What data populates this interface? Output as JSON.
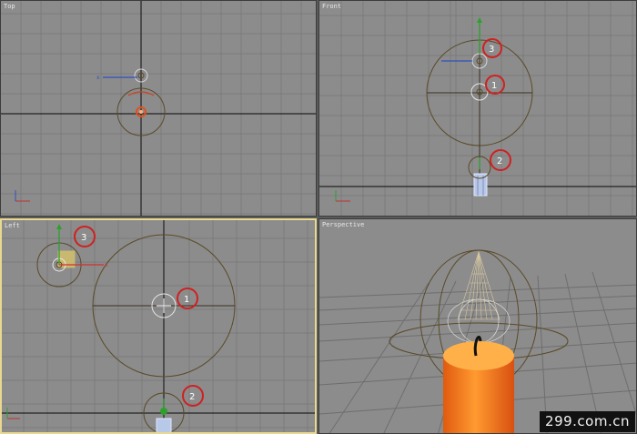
{
  "viewports": {
    "top": {
      "label": "Top"
    },
    "front": {
      "label": "Front"
    },
    "left": {
      "label": "Left"
    },
    "perspective": {
      "label": "Perspective"
    }
  },
  "markers": {
    "front": [
      "3",
      "1",
      "2"
    ],
    "left": [
      "3",
      "1",
      "2"
    ]
  },
  "axis_labels": {
    "x": "x",
    "y": "y",
    "z": "z"
  },
  "watermark": "299.com.cn",
  "colors": {
    "viewport_bg": "#8c8c8c",
    "grid": "#7d7d7d",
    "major_axis": "#1e1e1e",
    "helper": "#5a4a28",
    "marker_ring": "#d02020",
    "active_border": "#e8d890",
    "candle": "#f07818",
    "flame_mesh": "#d8c8a0"
  }
}
